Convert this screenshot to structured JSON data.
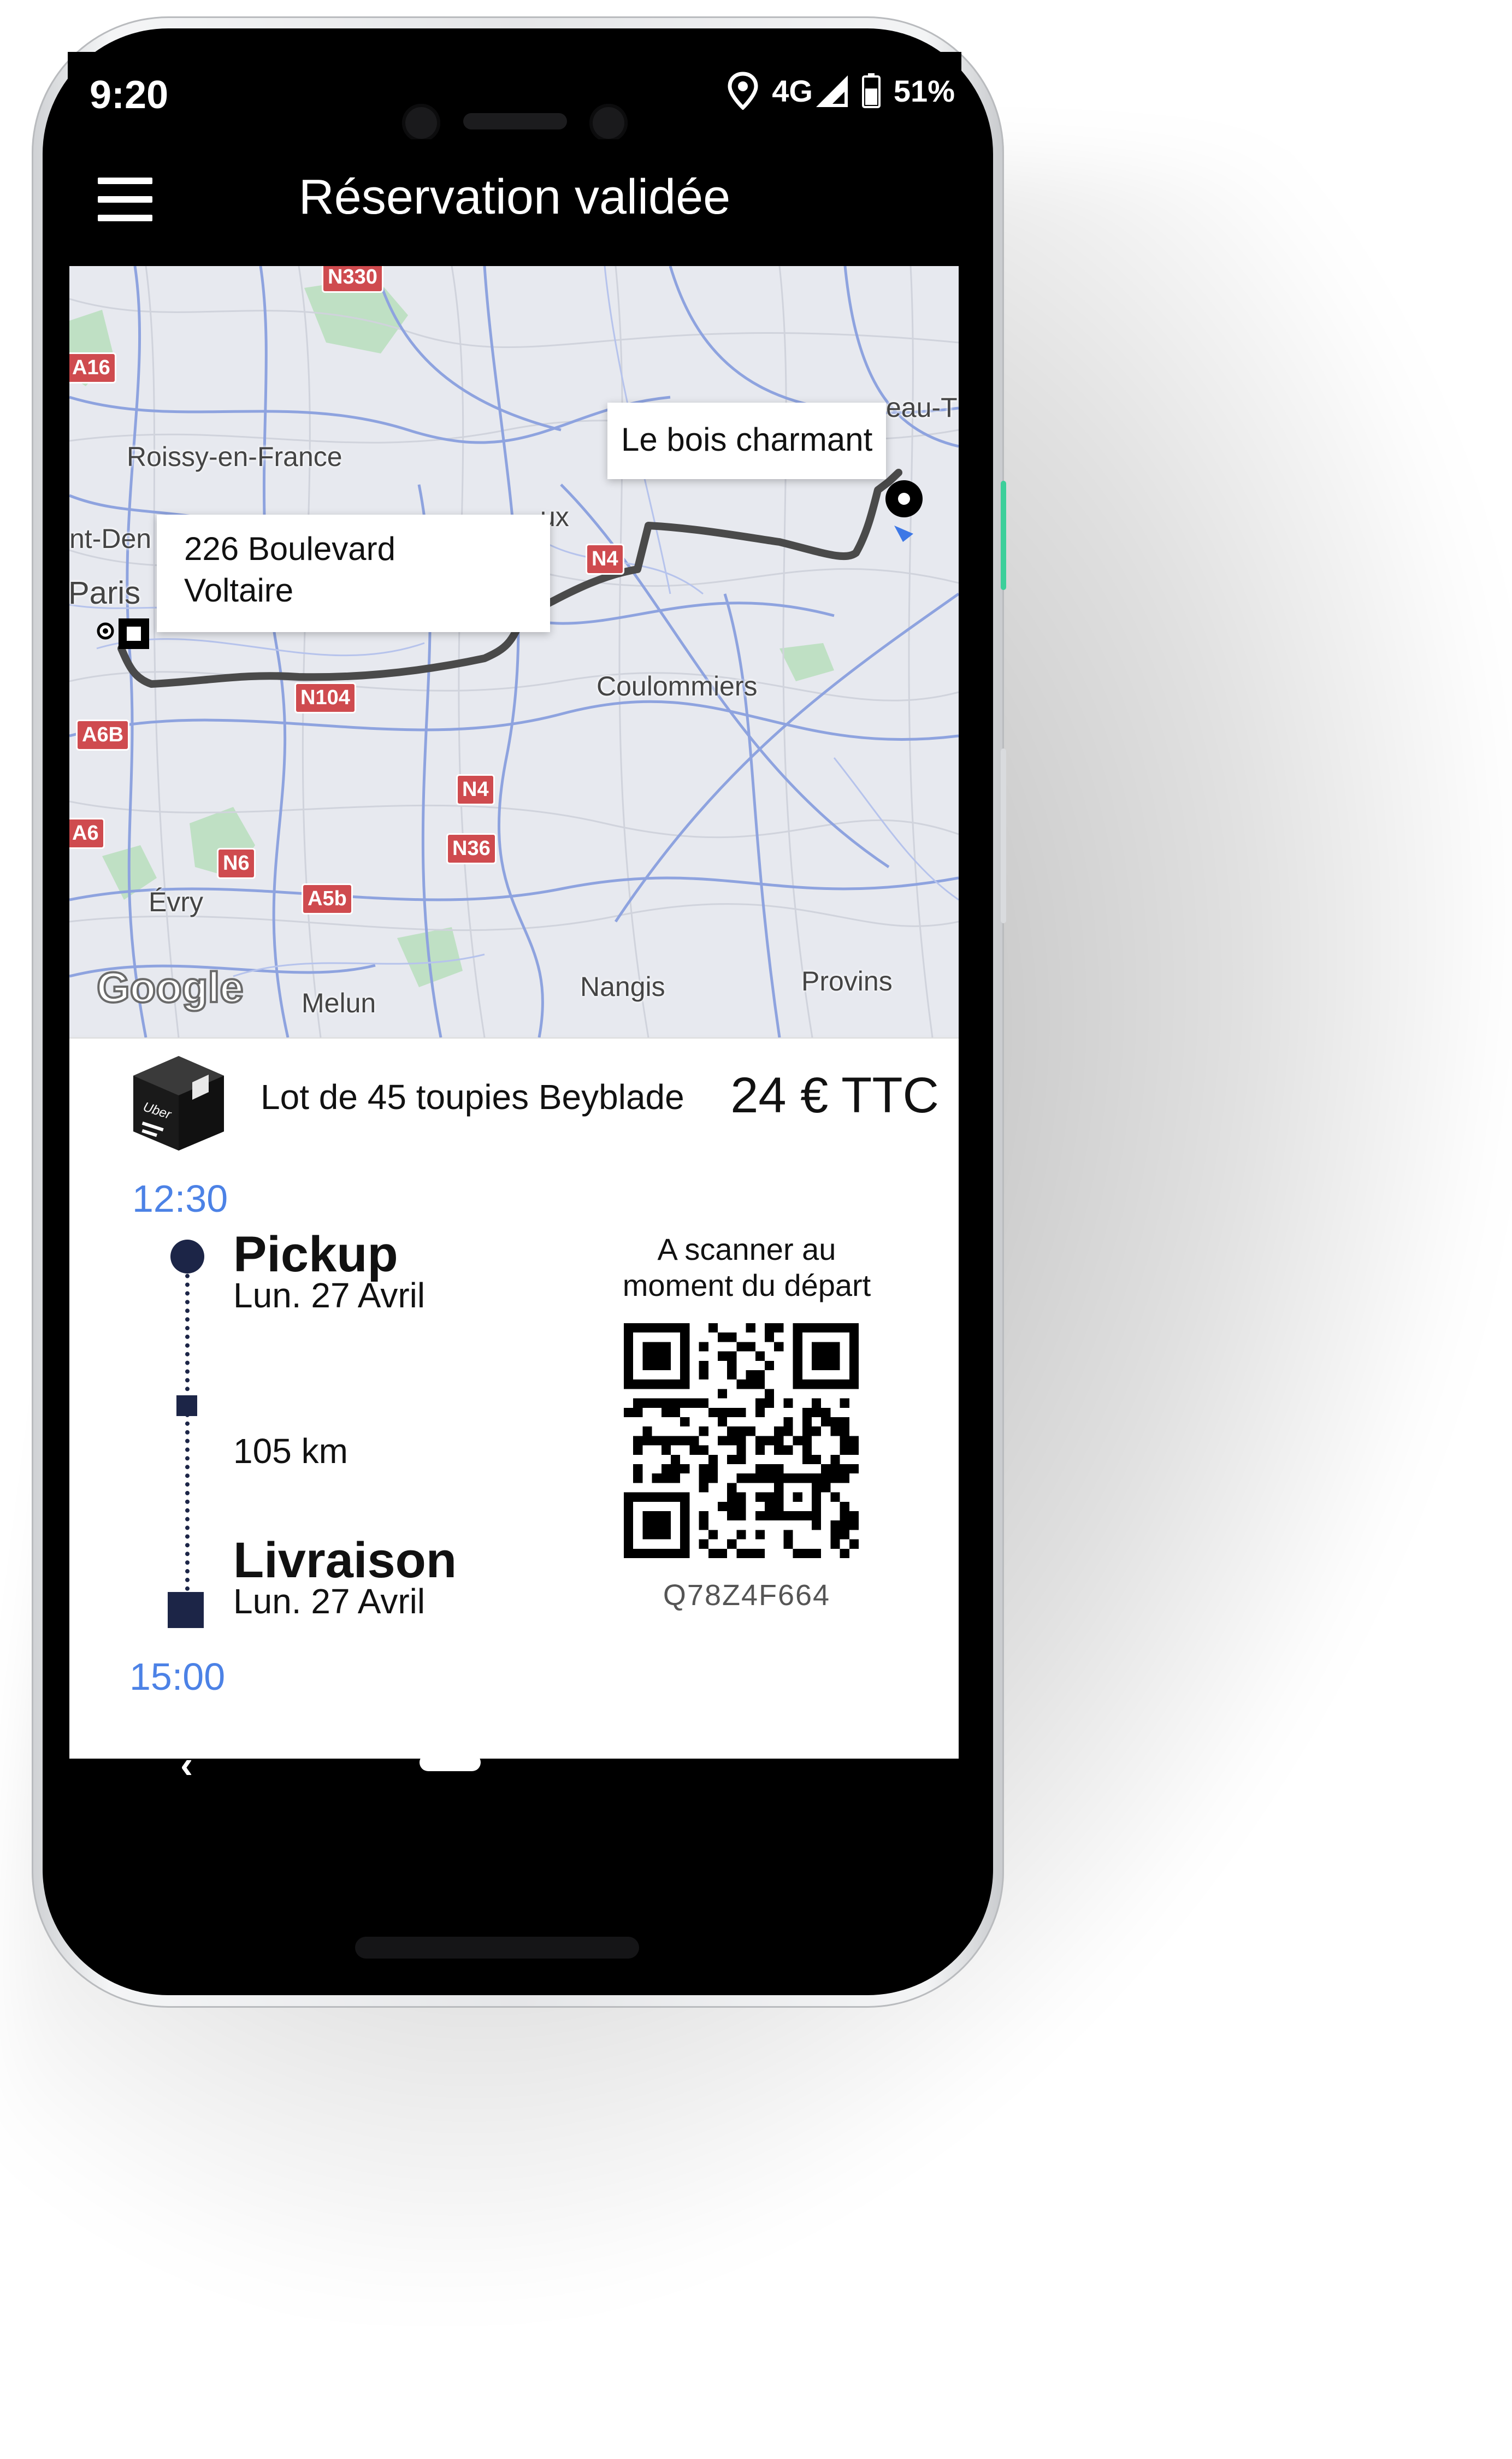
{
  "status_bar": {
    "time": "9:20",
    "network": "4G",
    "battery": "51%"
  },
  "app_bar": {
    "title": "Réservation validée",
    "menu_icon": "hamburger-menu-icon"
  },
  "map": {
    "origin_label": "226 Boulevard\nVoltaire",
    "destination_label": "Le bois charmant",
    "places": [
      "Roissy-en-France",
      "Paris",
      "Coulommiers",
      "Évry",
      "Melun",
      "Nangis",
      "Provins",
      "nt-Den",
      "eau-T",
      "ux"
    ],
    "roads": [
      "N330",
      "A16",
      "N104",
      "A6B",
      "A6",
      "N6",
      "A5b",
      "N4",
      "N36",
      "N4"
    ],
    "attribution": "Google"
  },
  "product": {
    "name": "Lot de 45 toupies Beyblade",
    "price": "24 € TTC",
    "box_brand": "Uber"
  },
  "trip": {
    "start_time": "12:30",
    "end_time": "15:00",
    "pickup": {
      "title": "Pickup",
      "date": "Lun. 27 Avril"
    },
    "distance": "105 km",
    "delivery": {
      "title": "Livraison",
      "date": "Lun. 27 Avril"
    }
  },
  "qr": {
    "instruction": "A scanner au\nmoment du départ",
    "code": "Q78Z4F664"
  },
  "colors": {
    "accent_blue": "#4c82e6",
    "timeline_navy": "#1c2547",
    "road_shield": "#cf4b4f"
  }
}
